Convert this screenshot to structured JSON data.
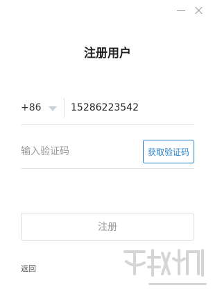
{
  "window": {
    "minimize_icon": "minimize-icon",
    "close_icon": "close-icon"
  },
  "form": {
    "title": "注册用户",
    "country_code": "+86",
    "phone_value": "15286223542",
    "code_placeholder": "输入验证码",
    "get_code_label": "获取验证码",
    "register_label": "注册",
    "back_label": "返回"
  },
  "colors": {
    "accent": "#2a80c9",
    "border": "#e4e4e4",
    "muted_text": "#9a9a9a"
  }
}
